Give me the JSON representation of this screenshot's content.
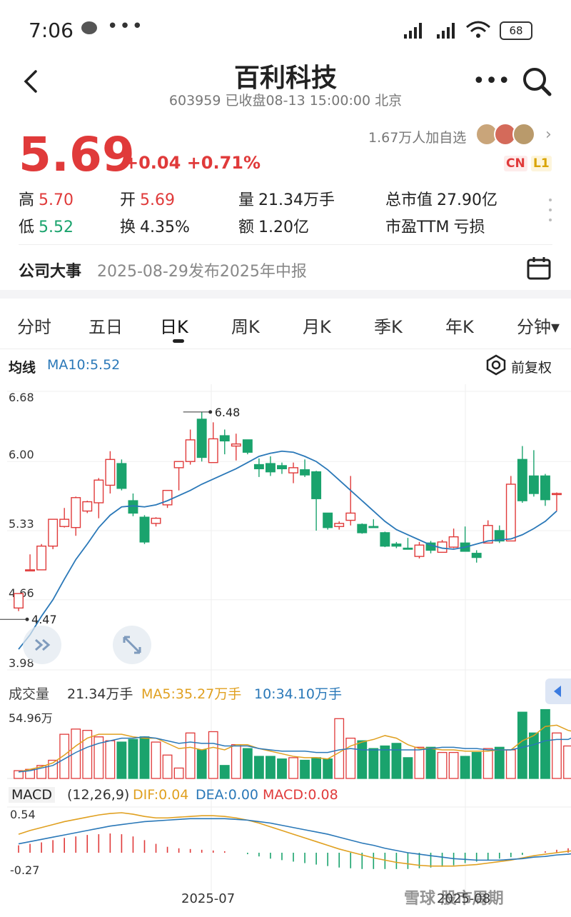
{
  "status_bar": {
    "time": "7:06",
    "dots": "•••",
    "battery": "68"
  },
  "header": {
    "title": "百利科技",
    "code": "603959",
    "status": "已收盘08-13 15:00:00 北京"
  },
  "quote": {
    "price": "5.69",
    "change": "+0.04 +0.71%",
    "followers": "1.67万人加自选",
    "badge_cn": "CN",
    "badge_l1": "L1",
    "stats": [
      {
        "label": "高",
        "value": "5.70",
        "tone": "red"
      },
      {
        "label": "开",
        "value": "5.69",
        "tone": "red"
      },
      {
        "label": "量",
        "value": "21.34万手",
        "tone": "plain"
      },
      {
        "label": "总市值",
        "value": "27.90亿",
        "tone": "plain"
      },
      {
        "label": "低",
        "value": "5.52",
        "tone": "green"
      },
      {
        "label": "换",
        "value": "4.35%",
        "tone": "plain"
      },
      {
        "label": "额",
        "value": "1.20亿",
        "tone": "plain"
      },
      {
        "label": "市盈TTM",
        "value": "亏损",
        "tone": "plain"
      }
    ]
  },
  "company_event": {
    "title": "公司大事",
    "text": "2025-08-29发布2025年中报"
  },
  "tabs": [
    "分时",
    "五日",
    "日K",
    "周K",
    "月K",
    "季K",
    "年K",
    "分钟▾"
  ],
  "active_tab": "日K",
  "kline_header": {
    "label": "均线",
    "ma10": "MA10:5.52",
    "adjust": "前复权"
  },
  "volume_header": {
    "label": "成交量",
    "vol": "21.34万手",
    "ma5": "MA5:35.27万手",
    "ma10": "10:34.10万手",
    "max_label": "54.96万"
  },
  "macd_header": {
    "label": "MACD",
    "params": "(12,26,9)",
    "dif": "DIF:0.04",
    "dea": "DEA:0.00",
    "macd": "MACD:0.08"
  },
  "x_labels": [
    "2025-07",
    "2025-08"
  ],
  "watermark": "雪球 股市周期",
  "colors": {
    "up": "#e03a3a",
    "down": "#1aa36d",
    "ma10": "#2a78b8",
    "ma5": "#e0a020",
    "dif": "#e0a020",
    "dea": "#2a78b8"
  },
  "chart_data": [
    {
      "type": "candlestick",
      "title": "日K",
      "ylim": [
        3.98,
        6.68
      ],
      "y_ticks": [
        "6.68",
        "6.00",
        "5.33",
        "4.66",
        "3.98"
      ],
      "annotations": [
        {
          "text": "6.48",
          "value": 6.48
        },
        {
          "text": "4.47",
          "value": 4.47
        }
      ],
      "candles": [
        {
          "o": 4.58,
          "c": 4.72,
          "h": 4.72,
          "l": 4.55
        },
        {
          "o": 4.95,
          "c": 4.95,
          "h": 5.1,
          "l": 4.95
        },
        {
          "o": 4.95,
          "c": 5.18,
          "h": 5.2,
          "l": 4.95
        },
        {
          "o": 5.18,
          "c": 5.44,
          "h": 5.44,
          "l": 5.15
        },
        {
          "o": 5.37,
          "c": 5.44,
          "h": 5.55,
          "l": 5.36
        },
        {
          "o": 5.36,
          "c": 5.65,
          "h": 5.66,
          "l": 5.28
        },
        {
          "o": 5.52,
          "c": 5.61,
          "h": 5.62,
          "l": 5.5
        },
        {
          "o": 5.6,
          "c": 5.82,
          "h": 5.84,
          "l": 5.45
        },
        {
          "o": 5.77,
          "c": 6.02,
          "h": 6.1,
          "l": 5.69
        },
        {
          "o": 5.98,
          "c": 5.74,
          "h": 6.02,
          "l": 5.72
        },
        {
          "o": 5.62,
          "c": 5.5,
          "h": 5.69,
          "l": 5.47
        },
        {
          "o": 5.46,
          "c": 5.22,
          "h": 5.48,
          "l": 5.2
        },
        {
          "o": 5.4,
          "c": 5.45,
          "h": 5.46,
          "l": 5.37
        },
        {
          "o": 5.58,
          "c": 5.72,
          "h": 5.72,
          "l": 5.55
        },
        {
          "o": 5.94,
          "c": 6.0,
          "h": 6.0,
          "l": 5.72
        },
        {
          "o": 6.0,
          "c": 6.21,
          "h": 6.31,
          "l": 5.97
        },
        {
          "o": 6.41,
          "c": 6.04,
          "h": 6.48,
          "l": 6.0
        },
        {
          "o": 5.99,
          "c": 6.22,
          "h": 6.38,
          "l": 5.99
        },
        {
          "o": 6.25,
          "c": 6.2,
          "h": 6.31,
          "l": 6.07
        },
        {
          "o": 6.15,
          "c": 6.17,
          "h": 6.27,
          "l": 6.01
        },
        {
          "o": 6.21,
          "c": 6.09,
          "h": 6.21,
          "l": 6.07
        },
        {
          "o": 5.97,
          "c": 5.93,
          "h": 6.03,
          "l": 5.85
        },
        {
          "o": 5.98,
          "c": 5.9,
          "h": 6.05,
          "l": 5.86
        },
        {
          "o": 5.96,
          "c": 5.93,
          "h": 5.99,
          "l": 5.88
        },
        {
          "o": 5.89,
          "c": 5.94,
          "h": 5.99,
          "l": 5.79
        },
        {
          "o": 5.92,
          "c": 5.87,
          "h": 6.02,
          "l": 5.85
        },
        {
          "o": 5.9,
          "c": 5.64,
          "h": 5.91,
          "l": 5.33
        },
        {
          "o": 5.5,
          "c": 5.36,
          "h": 5.5,
          "l": 5.34
        },
        {
          "o": 5.37,
          "c": 5.4,
          "h": 5.42,
          "l": 5.34
        },
        {
          "o": 5.43,
          "c": 5.5,
          "h": 5.86,
          "l": 5.38
        },
        {
          "o": 5.39,
          "c": 5.31,
          "h": 5.4,
          "l": 5.3
        },
        {
          "o": 5.37,
          "c": 5.36,
          "h": 5.44,
          "l": 5.36
        },
        {
          "o": 5.31,
          "c": 5.18,
          "h": 5.32,
          "l": 5.17
        },
        {
          "o": 5.2,
          "c": 5.18,
          "h": 5.22,
          "l": 5.16
        },
        {
          "o": 5.16,
          "c": 5.15,
          "h": 5.26,
          "l": 5.15
        },
        {
          "o": 5.08,
          "c": 5.19,
          "h": 5.22,
          "l": 5.06
        },
        {
          "o": 5.21,
          "c": 5.14,
          "h": 5.23,
          "l": 5.11
        },
        {
          "o": 5.12,
          "c": 5.22,
          "h": 5.24,
          "l": 5.12
        },
        {
          "o": 5.17,
          "c": 5.27,
          "h": 5.35,
          "l": 5.16
        },
        {
          "o": 5.21,
          "c": 5.13,
          "h": 5.37,
          "l": 5.13
        },
        {
          "o": 5.11,
          "c": 5.07,
          "h": 5.14,
          "l": 5.02
        },
        {
          "o": 5.21,
          "c": 5.38,
          "h": 5.43,
          "l": 5.21
        },
        {
          "o": 5.33,
          "c": 5.23,
          "h": 5.38,
          "l": 5.21
        },
        {
          "o": 5.23,
          "c": 5.78,
          "h": 5.86,
          "l": 5.23
        },
        {
          "o": 6.02,
          "c": 5.62,
          "h": 6.15,
          "l": 5.6
        },
        {
          "o": 5.86,
          "c": 5.69,
          "h": 6.11,
          "l": 5.66
        },
        {
          "o": 5.86,
          "c": 5.63,
          "h": 5.88,
          "l": 5.57
        },
        {
          "o": 5.69,
          "c": 5.69,
          "h": 5.7,
          "l": 5.52
        }
      ],
      "ma10": [
        4.18,
        4.32,
        4.5,
        4.66,
        4.86,
        5.05,
        5.2,
        5.36,
        5.48,
        5.56,
        5.57,
        5.56,
        5.58,
        5.62,
        5.67,
        5.72,
        5.78,
        5.83,
        5.88,
        5.93,
        5.99,
        6.05,
        6.08,
        6.1,
        6.09,
        6.05,
        6.0,
        5.92,
        5.82,
        5.72,
        5.62,
        5.52,
        5.42,
        5.34,
        5.29,
        5.24,
        5.19,
        5.16,
        5.15,
        5.17,
        5.2,
        5.23,
        5.24,
        5.25,
        5.29,
        5.35,
        5.42,
        5.52
      ]
    },
    {
      "type": "bar",
      "title": "成交量",
      "ylim": [
        0,
        54.96
      ],
      "values": [
        6,
        7,
        10,
        14,
        34,
        38,
        37,
        32,
        29,
        28,
        30,
        32,
        28,
        18,
        8,
        35,
        22,
        36,
        10,
        26,
        23,
        17,
        17,
        15,
        16,
        14,
        16,
        15,
        46,
        31,
        29,
        23,
        25,
        27,
        16,
        24,
        24,
        20,
        20,
        17,
        20,
        23,
        24,
        22,
        51,
        35,
        53,
        35,
        25,
        21
      ],
      "ma5": [
        5,
        7,
        9,
        12,
        18,
        25,
        31,
        34,
        34,
        34,
        32,
        31,
        31,
        27,
        23,
        24,
        22,
        24,
        22,
        26,
        26,
        23,
        21,
        19,
        17,
        16,
        16,
        15,
        20,
        25,
        28,
        30,
        33,
        31,
        26,
        23,
        23,
        22,
        22,
        21,
        21,
        21,
        22,
        22,
        29,
        33,
        40,
        41,
        37,
        35
      ],
      "ma10": [
        5,
        6,
        8,
        10,
        15,
        20,
        24,
        27,
        29,
        31,
        31,
        32,
        31,
        29,
        27,
        28,
        27,
        27,
        25,
        25,
        25,
        23,
        22,
        21,
        21,
        21,
        20,
        20,
        22,
        23,
        22,
        22,
        22,
        22,
        22,
        22,
        23,
        24,
        24,
        23,
        23,
        22,
        22,
        22,
        24,
        26,
        29,
        30,
        30,
        34
      ]
    },
    {
      "type": "macd",
      "title": "MACD",
      "ylim": [
        -0.27,
        0.54
      ],
      "y_ticks": [
        "0.54",
        "-0.27"
      ],
      "hist": [
        0.1,
        0.12,
        0.14,
        0.17,
        0.2,
        0.22,
        0.24,
        0.25,
        0.26,
        0.25,
        0.22,
        0.17,
        0.12,
        0.08,
        0.06,
        0.05,
        0.04,
        0.03,
        0.02,
        0.0,
        -0.02,
        -0.05,
        -0.08,
        -0.1,
        -0.12,
        -0.14,
        -0.16,
        -0.18,
        -0.2,
        -0.21,
        -0.22,
        -0.22,
        -0.22,
        -0.22,
        -0.22,
        -0.21,
        -0.2,
        -0.19,
        -0.17,
        -0.14,
        -0.12,
        -0.1,
        -0.08,
        -0.06,
        -0.03,
        0.0,
        0.02,
        0.04,
        0.06,
        0.08
      ],
      "dif": [
        0.25,
        0.3,
        0.34,
        0.38,
        0.42,
        0.45,
        0.48,
        0.51,
        0.53,
        0.54,
        0.52,
        0.49,
        0.47,
        0.47,
        0.48,
        0.49,
        0.5,
        0.5,
        0.49,
        0.47,
        0.44,
        0.4,
        0.35,
        0.3,
        0.25,
        0.2,
        0.15,
        0.1,
        0.05,
        0.01,
        -0.03,
        -0.07,
        -0.1,
        -0.13,
        -0.15,
        -0.17,
        -0.18,
        -0.18,
        -0.18,
        -0.17,
        -0.16,
        -0.14,
        -0.12,
        -0.1,
        -0.07,
        -0.04,
        -0.02,
        0.0,
        0.02,
        0.04
      ],
      "dea": [
        0.12,
        0.15,
        0.18,
        0.21,
        0.24,
        0.27,
        0.3,
        0.33,
        0.36,
        0.38,
        0.4,
        0.42,
        0.43,
        0.44,
        0.45,
        0.46,
        0.46,
        0.46,
        0.46,
        0.45,
        0.44,
        0.42,
        0.4,
        0.37,
        0.34,
        0.31,
        0.28,
        0.25,
        0.21,
        0.17,
        0.13,
        0.1,
        0.06,
        0.03,
        0.0,
        -0.02,
        -0.04,
        -0.06,
        -0.08,
        -0.09,
        -0.1,
        -0.1,
        -0.1,
        -0.09,
        -0.08,
        -0.06,
        -0.05,
        -0.03,
        -0.02,
        0.0
      ]
    }
  ]
}
